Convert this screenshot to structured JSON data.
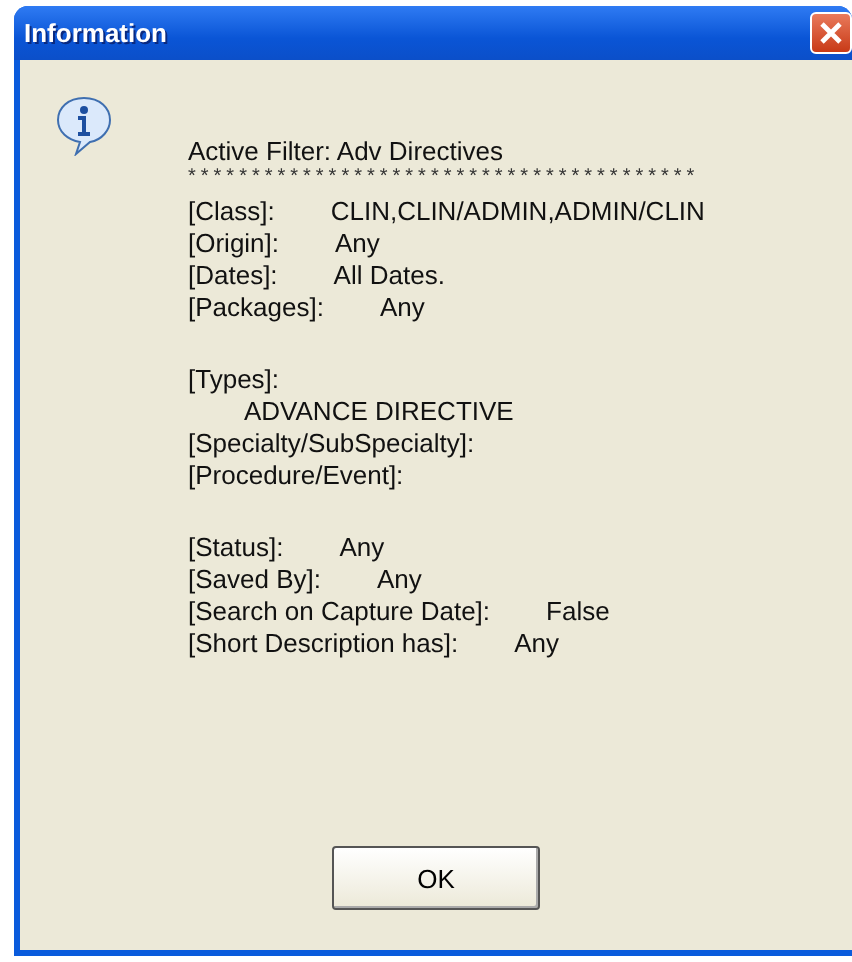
{
  "window": {
    "title": "Information"
  },
  "message": {
    "lines": [
      {
        "kind": "heading",
        "text": "Active Filter: Adv Directives"
      },
      {
        "kind": "rule",
        "text": "****************************************"
      },
      {
        "kind": "pair",
        "label": "[Class]:",
        "value": "CLIN,CLIN/ADMIN,ADMIN/CLIN"
      },
      {
        "kind": "pair",
        "label": "[Origin]:",
        "value": "Any"
      },
      {
        "kind": "pair",
        "label": "[Dates]:",
        "value": "All Dates."
      },
      {
        "kind": "pair",
        "label": "[Packages]:",
        "value": "Any"
      },
      {
        "kind": "gap"
      },
      {
        "kind": "heading",
        "text": "[Types]:"
      },
      {
        "kind": "indent",
        "text": "ADVANCE DIRECTIVE"
      },
      {
        "kind": "heading",
        "text": "[Specialty/SubSpecialty]:"
      },
      {
        "kind": "heading",
        "text": "[Procedure/Event]:"
      },
      {
        "kind": "gap"
      },
      {
        "kind": "pair",
        "label": "[Status]:",
        "value": "Any"
      },
      {
        "kind": "pair",
        "label": "[Saved By]:",
        "value": "Any"
      },
      {
        "kind": "pair",
        "label": "[Search on Capture Date]:",
        "value": "False"
      },
      {
        "kind": "pair",
        "label": "[Short Description has]:",
        "value": "Any"
      }
    ]
  },
  "buttons": [
    "OK"
  ]
}
